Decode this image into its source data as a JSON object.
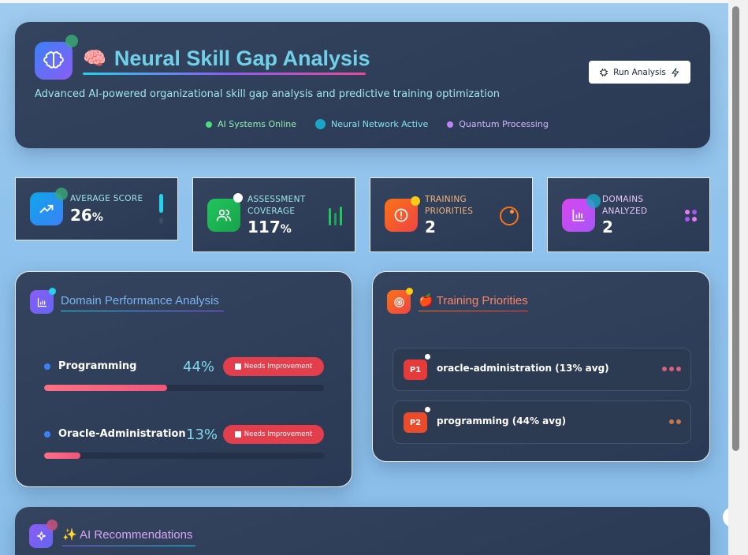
{
  "header": {
    "emoji": "🧠",
    "title": "Neural Skill Gap Analysis",
    "subtitle": "Advanced AI-powered organizational skill gap analysis and predictive training optimization",
    "run_button": "Run Analysis",
    "statuses": [
      {
        "label": "AI Systems Online",
        "color": "#4ade80"
      },
      {
        "label": "Neural Network Active",
        "color": "#22d3ee"
      },
      {
        "label": "Quantum Processing",
        "color": "#c084fc"
      }
    ]
  },
  "stats": [
    {
      "label": "AVERAGE SCORE",
      "value": "26",
      "suffix": "%",
      "icon": "trending-up-icon"
    },
    {
      "label": "ASSESSMENT COVERAGE",
      "value": "117",
      "suffix": "%",
      "icon": "users-icon"
    },
    {
      "label": "TRAINING PRIORITIES",
      "value": "2",
      "suffix": "",
      "icon": "alert-circle-icon"
    },
    {
      "label": "DOMAINS ANALYZED",
      "value": "2",
      "suffix": "",
      "icon": "bar-chart-icon"
    }
  ],
  "domain_performance": {
    "title": "Domain Performance Analysis",
    "rows": [
      {
        "name": "Programming",
        "percent": "44%",
        "fill": 0.44,
        "badge": "Needs Improvement"
      },
      {
        "name": "Oracle-Administration",
        "percent": "13%",
        "fill": 0.13,
        "badge": "Needs Improvement"
      }
    ]
  },
  "training_priorities": {
    "emoji": "🍎",
    "title": "Training Priorities",
    "items": [
      {
        "badge": "P1",
        "text": "oracle-administration (13% avg)"
      },
      {
        "badge": "P2",
        "text": "programming (44% avg)"
      }
    ]
  },
  "ai_recommendations": {
    "emoji": "✨",
    "title": "AI Recommendations"
  }
}
